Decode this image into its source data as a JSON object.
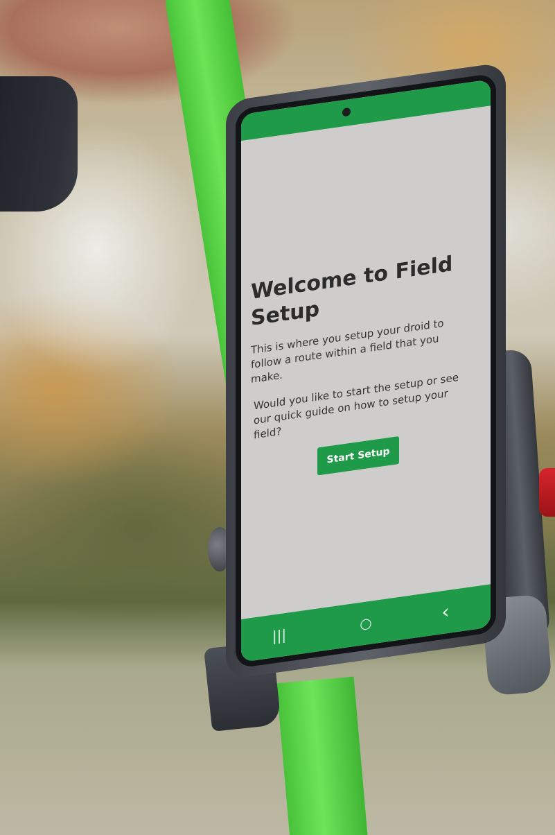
{
  "screen": {
    "title": "Welcome to Field Setup",
    "intro": "This is where you setup your droid to follow a route within a field that you make.",
    "question": "Would you like to start the setup or see our quick guide on how to setup your field?",
    "start_button_label": "Start Setup"
  },
  "nav_bar": {
    "items": [
      {
        "icon": "recent-apps-icon",
        "glyph": "|||"
      },
      {
        "icon": "home-icon",
        "glyph": "○"
      },
      {
        "icon": "back-icon",
        "glyph": "‹"
      }
    ]
  },
  "colors": {
    "accent": "#1f9a49",
    "screen_background": "#cfcccc",
    "pole": "#5fd64a",
    "knob": "#c81e25"
  }
}
